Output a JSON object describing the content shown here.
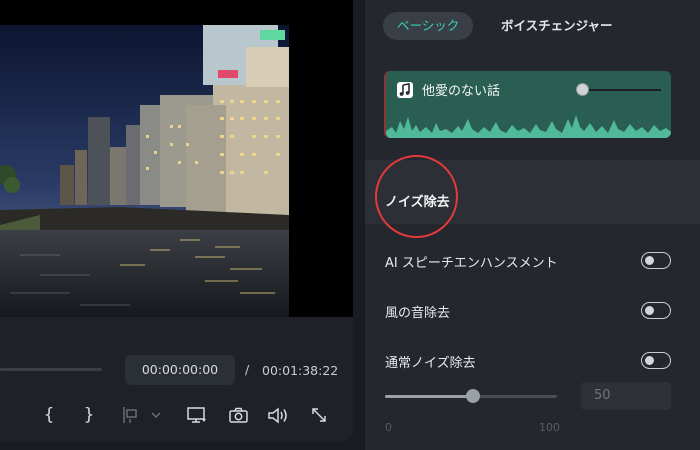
{
  "player": {
    "current_time": "00:00:00:00",
    "separator": "/",
    "total_time": "00:01:38:22",
    "controls": [
      {
        "name": "mark-in-icon",
        "glyph": "{"
      },
      {
        "name": "mark-out-icon",
        "glyph": "}"
      },
      {
        "name": "insert-clip-icon"
      },
      {
        "name": "insert-dropdown-icon"
      },
      {
        "name": "display-settings-icon"
      },
      {
        "name": "snapshot-camera-icon"
      },
      {
        "name": "volume-icon"
      },
      {
        "name": "fullscreen-icon"
      }
    ]
  },
  "panel": {
    "tabs": [
      {
        "label": "ベーシック",
        "active": true
      },
      {
        "label": "ボイスチェンジャー",
        "active": false
      }
    ],
    "audio_clip": {
      "title": "他愛のない話",
      "volume": 0.0
    },
    "section_title": "ノイズ除去",
    "options": [
      {
        "label": "AI スピーチエンハンスメント",
        "enabled": false
      },
      {
        "label": "風の音除去",
        "enabled": false
      },
      {
        "label": "通常ノイズ除去",
        "enabled": false
      }
    ],
    "noise_level": {
      "value": "50",
      "min_label": "0",
      "max_label": "100",
      "fraction": 0.5
    }
  },
  "colors": {
    "accent": "#35d6b7",
    "audio_clip_bg": "#2b5e52",
    "waveform": "#57c9a6",
    "highlight_circle": "#e23a3a"
  }
}
